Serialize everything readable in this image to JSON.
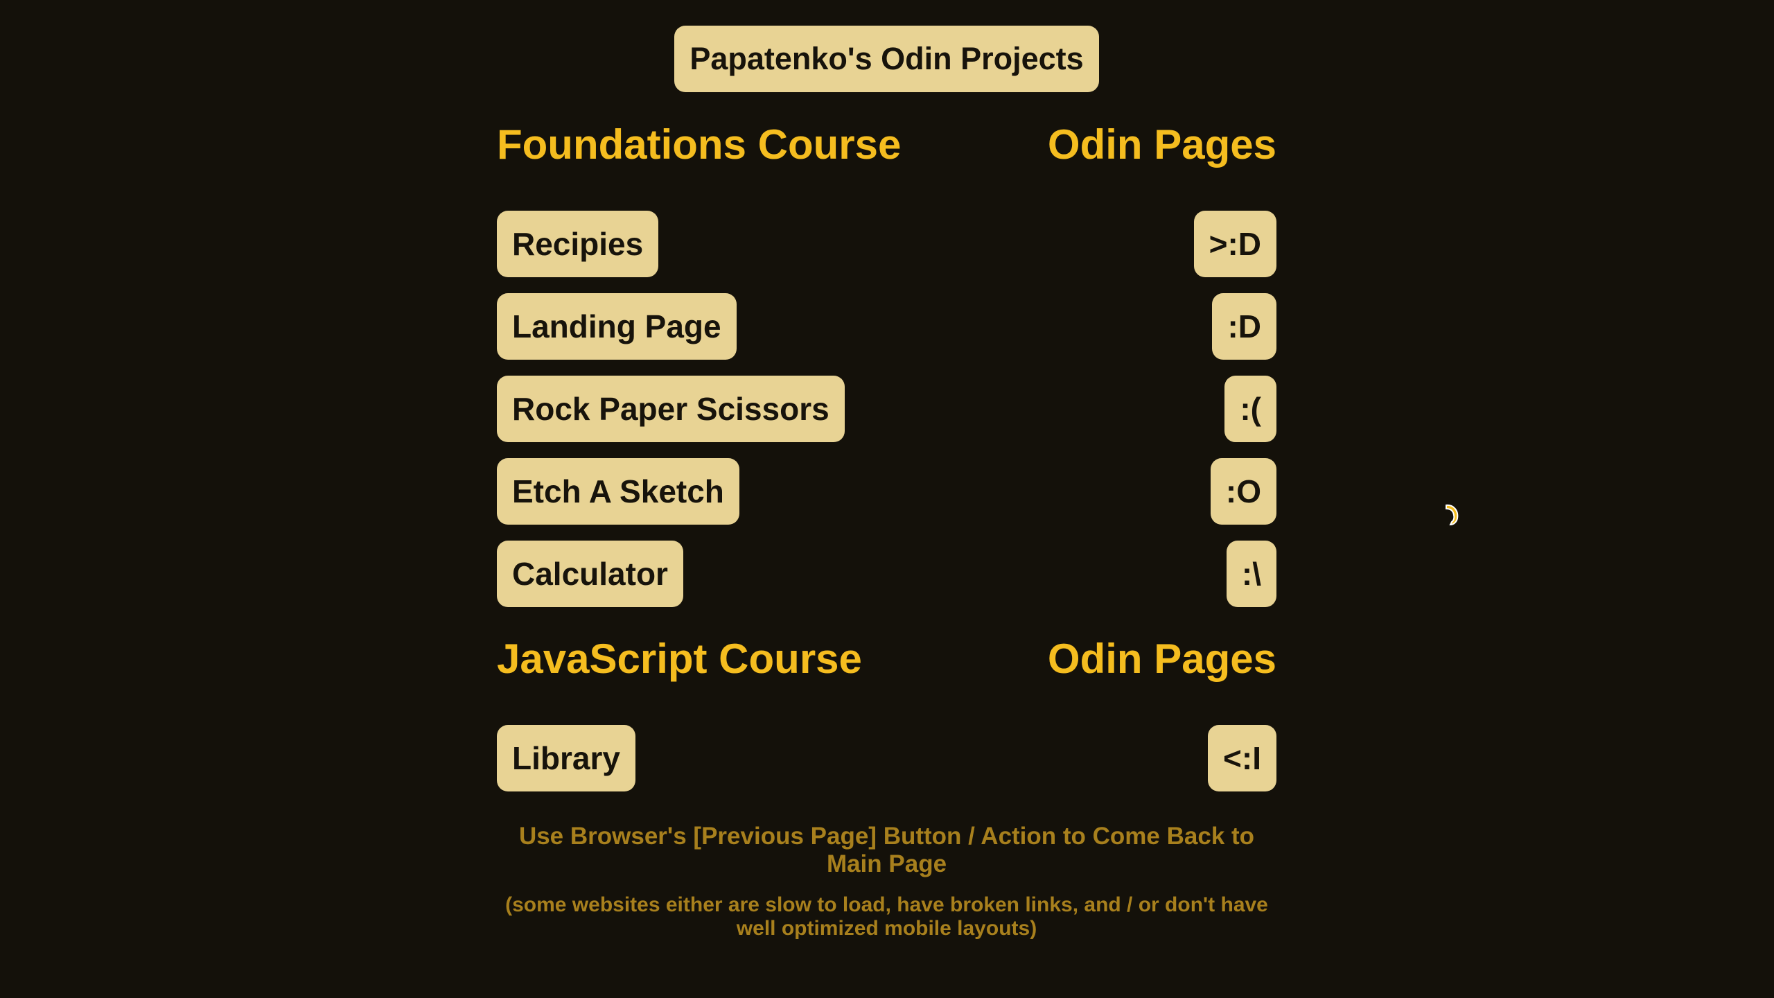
{
  "header": {
    "title": "Papatenko's Odin Projects"
  },
  "foundations": {
    "heading_left": "Foundations Course",
    "heading_right": "Odin Pages",
    "rows": [
      {
        "project": "Recipies",
        "page": ">:D"
      },
      {
        "project": "Landing Page",
        "page": ":D"
      },
      {
        "project": "Rock Paper Scissors",
        "page": ":("
      },
      {
        "project": "Etch A Sketch",
        "page": ":O"
      },
      {
        "project": "Calculator",
        "page": ":\\"
      }
    ]
  },
  "javascript": {
    "heading_left": "JavaScript Course",
    "heading_right": "Odin Pages",
    "rows": [
      {
        "project": "Library",
        "page": "<:I"
      }
    ]
  },
  "footer": {
    "note_main": "Use Browser's [Previous Page] Button / Action to Come Back to Main Page",
    "note_sub": "(some websites either are slow to load, have broken links, and / or don't have well optimized mobile layouts)"
  },
  "colors": {
    "background": "#14110a",
    "button": "#e8d394",
    "heading": "#f5bd1f",
    "note": "#a8801d"
  },
  "cursor": {
    "icon": "pointer-cursor-icon"
  }
}
